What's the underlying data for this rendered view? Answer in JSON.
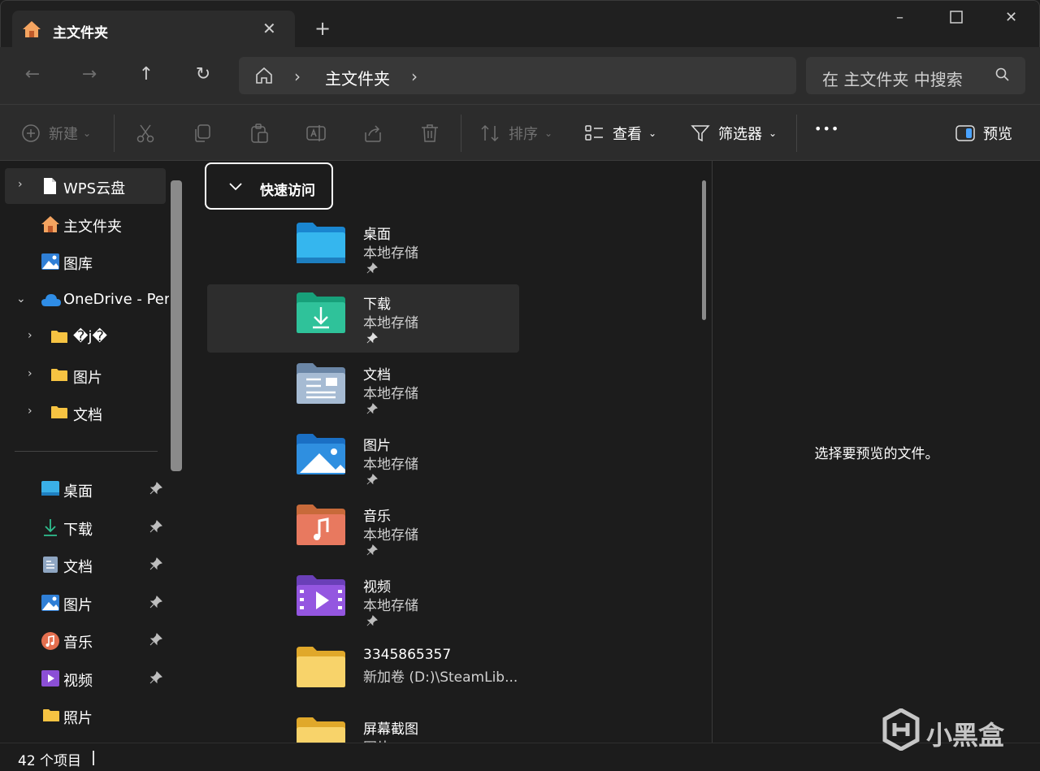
{
  "window": {
    "tab_title": "主文件夹",
    "controls": {
      "minimize": "–",
      "maximize": "□",
      "close": "✕"
    }
  },
  "address_bar": {
    "crumb": "主文件夹",
    "search_placeholder": "在 主文件夹 中搜索"
  },
  "command_bar": {
    "new_label": "新建",
    "sort_label": "排序",
    "view_label": "查看",
    "filter_label": "筛选器",
    "more_label": "•••",
    "preview_label": "预览"
  },
  "nav": {
    "items": [
      {
        "label": "WPS云盘",
        "icon": "document-icon"
      },
      {
        "label": "主文件夹",
        "icon": "home-icon"
      },
      {
        "label": "图库",
        "icon": "gallery-icon"
      },
      {
        "label": "OneDrive - Pers",
        "icon": "cloud-icon"
      },
      {
        "label": "�j�",
        "icon": "folder-icon"
      },
      {
        "label": "图片",
        "icon": "folder-icon"
      },
      {
        "label": "文档",
        "icon": "folder-icon"
      }
    ],
    "pinned": [
      {
        "label": "桌面",
        "icon": "desktop-icon"
      },
      {
        "label": "下载",
        "icon": "download-icon"
      },
      {
        "label": "文档",
        "icon": "documents-icon"
      },
      {
        "label": "图片",
        "icon": "pictures-icon"
      },
      {
        "label": "音乐",
        "icon": "music-icon"
      },
      {
        "label": "视频",
        "icon": "videos-icon"
      },
      {
        "label": "照片",
        "icon": "folder-icon"
      }
    ]
  },
  "content": {
    "group_label": "快速访问",
    "tiles": [
      {
        "name": "桌面",
        "sub": "本地存储"
      },
      {
        "name": "下载",
        "sub": "本地存储"
      },
      {
        "name": "文档",
        "sub": "本地存储"
      },
      {
        "name": "图片",
        "sub": "本地存储"
      },
      {
        "name": "音乐",
        "sub": "本地存储"
      },
      {
        "name": "视频",
        "sub": "本地存储"
      },
      {
        "name": "3345865357",
        "sub": "新加卷 (D:)\\SteamLib..."
      },
      {
        "name": "屏幕截图",
        "sub": "图片"
      }
    ]
  },
  "preview": {
    "message": "选择要预览的文件。"
  },
  "status": {
    "count": "42 个项目"
  },
  "watermark": {
    "text": "小黑盒"
  },
  "colors": {
    "background": "#1c1c1c",
    "toolbar": "#2c2c2c",
    "selection": "#2d2d2d",
    "folder_yellow": "#f6c342"
  }
}
